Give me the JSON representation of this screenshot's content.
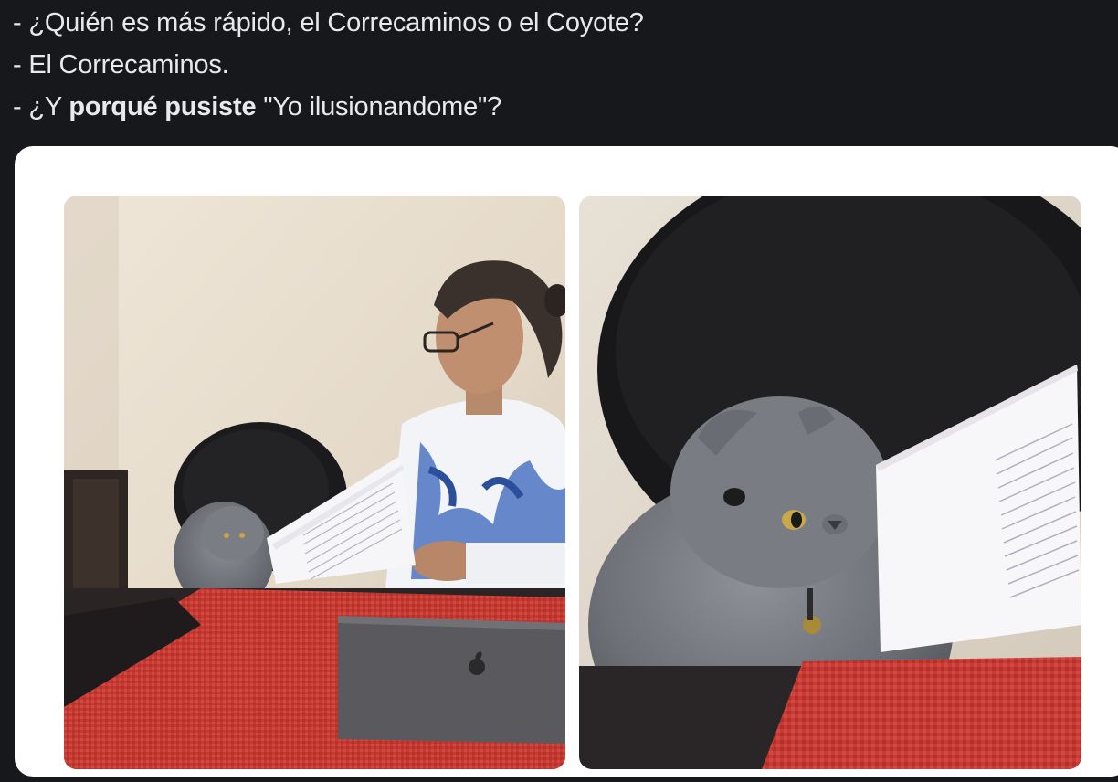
{
  "tweet": {
    "line1": "- ¿Quién es más rápido, el Correcaminos o el Coyote?",
    "line2": "- El Correcaminos.",
    "line3_prefix": "- ¿Y ",
    "line3_bold": "porqué pusiste",
    "line3_suffix": " \"Yo ilusionandome\"?"
  },
  "media": {
    "left_panel": "woman-reading-papers-with-cat",
    "right_panel": "cat-closeup-with-papers"
  },
  "colors": {
    "background": "#16181c",
    "text": "#e7e9ea",
    "card": "#ffffff",
    "tablecloth": "#c83a34"
  }
}
